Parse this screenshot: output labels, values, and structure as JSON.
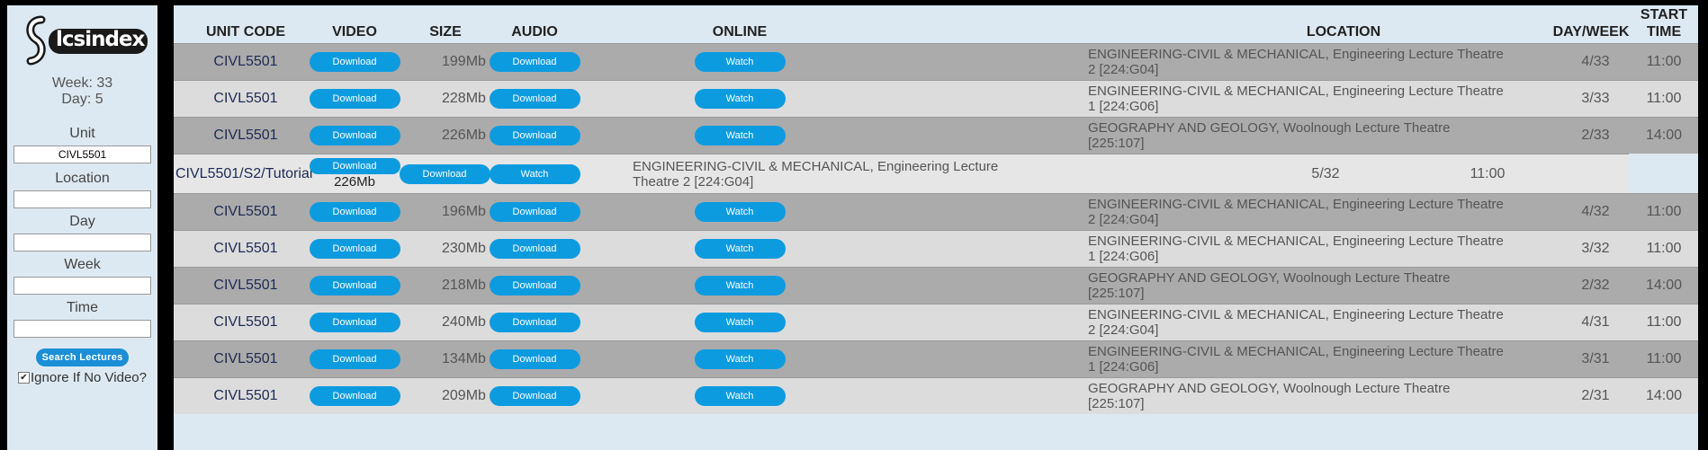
{
  "sidebar": {
    "logo_text": "lcsindex",
    "week_label": "Week: 33",
    "day_label": "Day: 5",
    "unit_label": "Unit",
    "unit_value": "CIVL5501",
    "location_label": "Location",
    "location_value": "",
    "day_field_label": "Day",
    "day_value": "",
    "week_field_label": "Week",
    "week_value": "",
    "time_label": "Time",
    "time_value": "",
    "search_button": "Search Lectures",
    "ignore_label": "Ignore If No Video?",
    "ignore_checked": true
  },
  "table": {
    "headers": {
      "unit_code": "UNIT CODE",
      "video": "VIDEO",
      "size": "SIZE",
      "audio": "AUDIO",
      "online": "ONLINE",
      "location": "LOCATION",
      "day_week": "DAY/WEEK",
      "start_time_1": "START",
      "start_time_2": "TIME"
    },
    "rows": [
      {
        "unit": "CIVL5501",
        "video": "Download",
        "size": "199Mb",
        "audio": "Download",
        "online": "Watch",
        "loc1": "ENGINEERING-CIVIL & MECHANICAL, Engineering Lecture Theatre",
        "loc2": "2 [224:G04]",
        "dw": "4/33",
        "time": "11:00"
      },
      {
        "unit": "CIVL5501",
        "video": "Download",
        "size": "228Mb",
        "audio": "Download",
        "online": "Watch",
        "loc1": "ENGINEERING-CIVIL & MECHANICAL, Engineering Lecture Theatre",
        "loc2": "1 [224:G06]",
        "dw": "3/33",
        "time": "11:00"
      },
      {
        "unit": "CIVL5501",
        "video": "Download",
        "size": "226Mb",
        "audio": "Download",
        "online": "Watch",
        "loc1": "GEOGRAPHY AND GEOLOGY, Woolnough Lecture Theatre",
        "loc2": "[225:107]",
        "dw": "2/33",
        "time": "14:00"
      },
      {
        "unit": "CIVL5501/S2/Tutorial",
        "video": "Download",
        "size": "226Mb",
        "audio": "Download",
        "online": "Watch",
        "loc1": "ENGINEERING-CIVIL & MECHANICAL, Engineering Lecture",
        "loc2": "Theatre 2 [224:G04]",
        "dw": "5/32",
        "time": "11:00"
      },
      {
        "unit": "CIVL5501",
        "video": "Download",
        "size": "196Mb",
        "audio": "Download",
        "online": "Watch",
        "loc1": "ENGINEERING-CIVIL & MECHANICAL, Engineering Lecture Theatre",
        "loc2": "2 [224:G04]",
        "dw": "4/32",
        "time": "11:00"
      },
      {
        "unit": "CIVL5501",
        "video": "Download",
        "size": "230Mb",
        "audio": "Download",
        "online": "Watch",
        "loc1": "ENGINEERING-CIVIL & MECHANICAL, Engineering Lecture Theatre",
        "loc2": "1 [224:G06]",
        "dw": "3/32",
        "time": "11:00"
      },
      {
        "unit": "CIVL5501",
        "video": "Download",
        "size": "218Mb",
        "audio": "Download",
        "online": "Watch",
        "loc1": "GEOGRAPHY AND GEOLOGY, Woolnough Lecture Theatre",
        "loc2": "[225:107]",
        "dw": "2/32",
        "time": "14:00"
      },
      {
        "unit": "CIVL5501",
        "video": "Download",
        "size": "240Mb",
        "audio": "Download",
        "online": "Watch",
        "loc1": "ENGINEERING-CIVIL & MECHANICAL, Engineering Lecture Theatre",
        "loc2": "2 [224:G04]",
        "dw": "4/31",
        "time": "11:00"
      },
      {
        "unit": "CIVL5501",
        "video": "Download",
        "size": "134Mb",
        "audio": "Download",
        "online": "Watch",
        "loc1": "ENGINEERING-CIVIL & MECHANICAL, Engineering Lecture Theatre",
        "loc2": "1 [224:G06]",
        "dw": "3/31",
        "time": "11:00"
      },
      {
        "unit": "CIVL5501",
        "video": "Download",
        "size": "209Mb",
        "audio": "Download",
        "online": "Watch",
        "loc1": "GEOGRAPHY AND GEOLOGY, Woolnough Lecture Theatre",
        "loc2": "[225:107]",
        "dw": "2/31",
        "time": "14:00"
      }
    ]
  },
  "colors": {
    "panel_bg": "#dde9f2",
    "row_dark": "#ababab",
    "row_light": "#dcdcdc",
    "button_blue": "#0d9be0",
    "unit_text": "#1e2a55"
  }
}
